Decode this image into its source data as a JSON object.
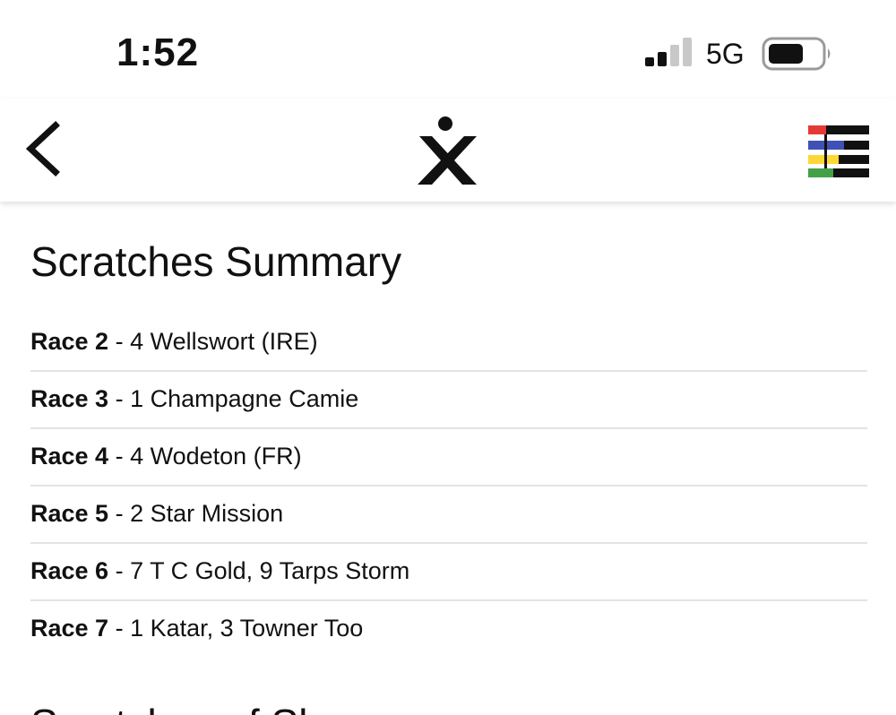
{
  "status_bar": {
    "time": "1:52",
    "network": "5G",
    "signal_icon": "cellular-signal-icon",
    "battery_icon": "battery-icon"
  },
  "header": {
    "back_icon": "chevron-left-icon",
    "logo_icon": "x-figure-logo",
    "menu_icon": "striped-menu-icon",
    "menu_colors": [
      "#e53935",
      "#3f51b5",
      "#fdd835",
      "#43a047"
    ]
  },
  "page": {
    "title": "Scratches Summary",
    "scratches": [
      {
        "race": "Race 2",
        "separator": " - ",
        "detail": "4 Wellswort (IRE)"
      },
      {
        "race": "Race 3",
        "separator": " - ",
        "detail": "1 Champagne Camie"
      },
      {
        "race": "Race 4",
        "separator": " - ",
        "detail": "4 Wodeton (FR)"
      },
      {
        "race": "Race 5",
        "separator": " - ",
        "detail": "2 Star Mission"
      },
      {
        "race": "Race 6",
        "separator": " - ",
        "detail": "7 T C Gold, 9 Tarps Storm"
      },
      {
        "race": "Race 7",
        "separator": " - ",
        "detail": "1 Katar, 3 Towner Too"
      }
    ],
    "next_heading": "Scratches of Sha..."
  }
}
